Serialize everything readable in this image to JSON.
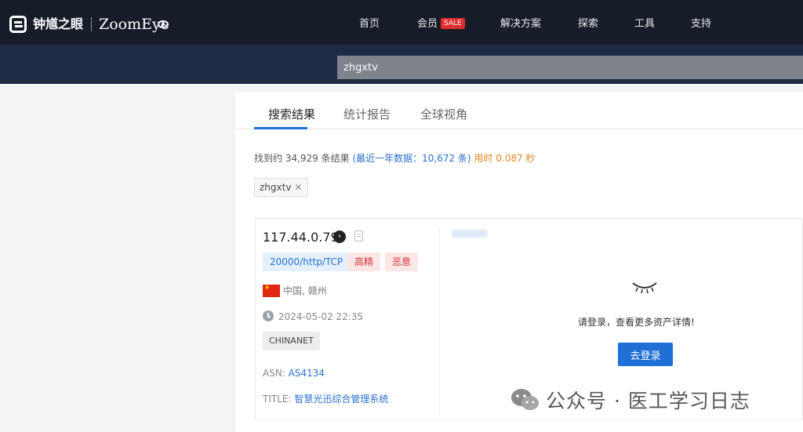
{
  "header": {
    "logo_cn": "钟馗之眼",
    "logo_en": "ZoomEye",
    "nav": [
      "首页",
      "会员",
      "解决方案",
      "探索",
      "工具",
      "支持"
    ],
    "sale_badge": "SALE"
  },
  "search": {
    "value": "zhgxtv"
  },
  "tabs": [
    "搜索结果",
    "统计报告",
    "全球视角"
  ],
  "summary": {
    "prefix": "找到约 34,929 条结果 ",
    "recent": "(最近一年数据：10,672 条)",
    "time": " 用时 0.087 秒"
  },
  "filter": {
    "tag": "zhgxtv",
    "close": "✕"
  },
  "result": {
    "ip": "117.44.0.79",
    "arrow": "›",
    "port_badge": "20000/http/TCP",
    "tag1": "高精",
    "tag2": "恶意",
    "location": "中国, 赣州",
    "time": "2024-05-02 22:35",
    "isp": "CHINANET",
    "asn_label": "ASN: ",
    "asn_value": "AS4134",
    "title_label": "TITLE: ",
    "title_value": "智慧光迅综合管理系统"
  },
  "login_panel": {
    "message": "请登录，查看更多资产详情!",
    "button": "去登录"
  },
  "watermark": {
    "text": "公众号 · 医工学习日志"
  },
  "colors": {
    "nav_bg": "#161c28",
    "band_bg": "#1f2a44",
    "accent_blue": "#1f6fd6",
    "sale_red": "#e02e2e",
    "tag_red": "#d63b3b",
    "orange": "#e08a21"
  },
  "icons": [
    "logo-icon",
    "eye-logo-icon",
    "arrow-circle-icon",
    "copy-icon",
    "china-flag-icon",
    "clock-icon",
    "closed-eye-icon",
    "wechat-icon",
    "close-icon"
  ]
}
